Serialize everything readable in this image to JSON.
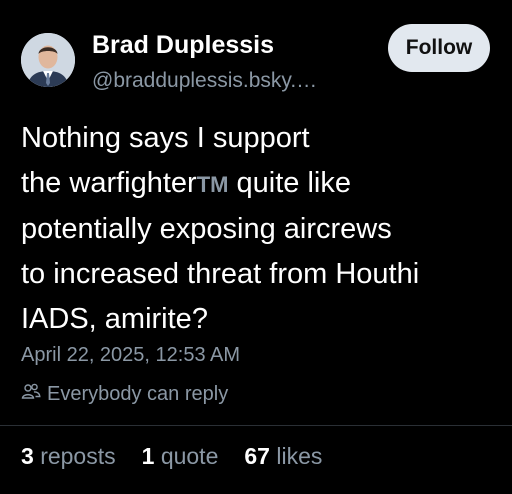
{
  "author": {
    "display_name": "Brad Duplessis",
    "handle": "@bradduplessis.bsky.…"
  },
  "follow_label": "Follow",
  "post": {
    "lines": [
      "Nothing says I support",
      "the warfighter",
      " quite like",
      "potentially exposing aircrews",
      "to increased threat from Houthi",
      "IADS, amirite?"
    ],
    "tm": "TM"
  },
  "timestamp": "April 22, 2025, 12:53 AM",
  "reply_setting": {
    "icon": "people-icon",
    "label": "Everybody can reply"
  },
  "stats": {
    "reposts_count": "3",
    "reposts_label": "reposts",
    "quote_count": "1",
    "quote_label": "quote",
    "likes_count": "67",
    "likes_label": "likes"
  },
  "colors": {
    "background": "#000000",
    "text": "#ffffff",
    "secondary": "#8b98a5",
    "follow_bg": "#e2e8ef"
  }
}
